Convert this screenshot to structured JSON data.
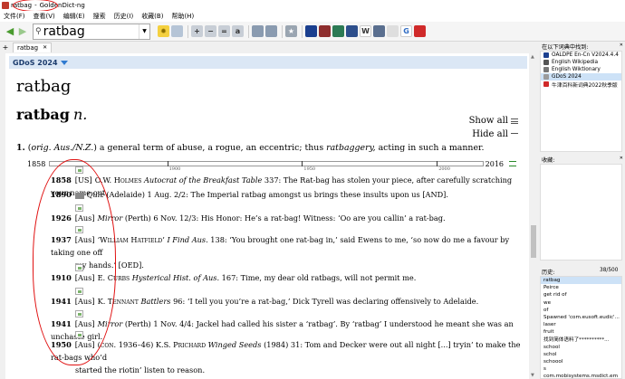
{
  "window": {
    "title_word": "ratbag",
    "title_app": "GoldenDict-ng"
  },
  "menu": [
    "文件(F)",
    "查看(V)",
    "编辑(E)",
    "搜索",
    "历史(I)",
    "收藏(B)",
    "帮助(H)"
  ],
  "search": {
    "value": "ratbag"
  },
  "tab": {
    "label": "ratbag"
  },
  "dictionary": {
    "name": "GDoS 2024",
    "headword": "ratbag",
    "headword_pos_word": "ratbag",
    "headword_pos": "n.",
    "show_all": "Show all",
    "hide_all": "Hide all"
  },
  "sense": {
    "num": "1.",
    "label_open": "(",
    "label_a": "orig.",
    "label_b": "Aus./N.Z.",
    "label_close": ")",
    "text_a": "a general term of abuse, a rogue, an eccentric; thus ",
    "text_italic": "ratbaggery,",
    "text_b": " acting in such a manner."
  },
  "timeline": {
    "start": "1858",
    "end": "2016",
    "ticks": [
      {
        "label": "1900",
        "pos": 0.27
      },
      {
        "label": "1950",
        "pos": 0.58
      },
      {
        "label": "2000",
        "pos": 0.89
      }
    ]
  },
  "quotes": [
    {
      "year": "1858",
      "region": "[US]",
      "author": "O.W. Holmes",
      "source": "Autocrat of the Breakfast Table",
      "text": " 337: The Rat-bag has stolen your piece, after carefully scratching your name out."
    },
    {
      "year": "1890",
      "region": "",
      "author": "",
      "source": "Quiz",
      "text": " (Adelaide) 1 Aug. 2/2: The Imperial ratbag amongst us brings these insults upon us [AND]."
    },
    {
      "year": "1926",
      "region": "[Aus]",
      "author": "",
      "source": "Mirror",
      "text": " (Perth) 6 Nov. 12/3: His Honor: He’s a rat-bag! Witness: ‘Oo are you callin’ a rat-bag."
    },
    {
      "year": "1937",
      "region": "[Aus]",
      "author": "‘William Hatfield’",
      "source": "I Find Aus.",
      "text": " 138: ‘You brought one rat-bag in,’ said Ewens to me, ‘so now do me a favour by taking one off",
      "cont": "my hands.’ [OED]."
    },
    {
      "year": "1910",
      "region": "[Aus]",
      "author": "E. Curbs",
      "source": "Hysterical Hist. of Aus.",
      "text": " 167: Time, my dear old ratbags, will not permit me."
    },
    {
      "year": "1941",
      "region": "[Aus]",
      "author": "K. Tennant",
      "source": "Battlers",
      "text": " 96: ‘I tell you you’re a rat-bag,’ Dick Tyrell was declaring offensively to Adelaide."
    },
    {
      "year": "1941",
      "region": "[Aus]",
      "author": "",
      "source": "Mirror",
      "text": " (Perth) 1 Nov. 4/4: Jackel had called his sister a ‘ratbag’. By ‘ratbag’ I understood he meant she was an unchaste girl."
    },
    {
      "year": "1950",
      "region": "[Aus]",
      "author": "(con. 1936–46) K.S. Prichard",
      "source": "Winged Seeds",
      "text": " (1984) 31: Tom and Decker were out all night [...] tryin’ to make the rat-bags who’d",
      "cont": "started the riotin’ listen to reason."
    }
  ],
  "found_panel": {
    "title": "在以下词典中找到:",
    "items": [
      {
        "label": "OALDPE En-Cn V2024.4.4",
        "color": "#1b3f8f"
      },
      {
        "label": "English Wikipedia",
        "color": "#555555"
      },
      {
        "label": "English Wiktionary",
        "color": "#777777"
      },
      {
        "label": "GDoS 2024",
        "color": "#9b9b9b"
      },
      {
        "label": "牛津百科新词典2022秋季版",
        "color": "#d02a2a"
      }
    ]
  },
  "notes_panel": {
    "title": "收藏:"
  },
  "history_panel": {
    "title": "历史:",
    "count": "38/500",
    "items": [
      "ratbag",
      "Peirce",
      "get rid of",
      "we",
      "of",
      "Spawned 'com.eusoft.eudic'...",
      "laser",
      "fruit",
      "找到简体语料了**********...",
      "school",
      "schol",
      "schoool",
      "s",
      "com.mobisystems.msdict.em"
    ]
  },
  "colors": {
    "accent": "#2f7ad0",
    "annotation": "#e01010",
    "header_bg": "#dbe7f5"
  }
}
